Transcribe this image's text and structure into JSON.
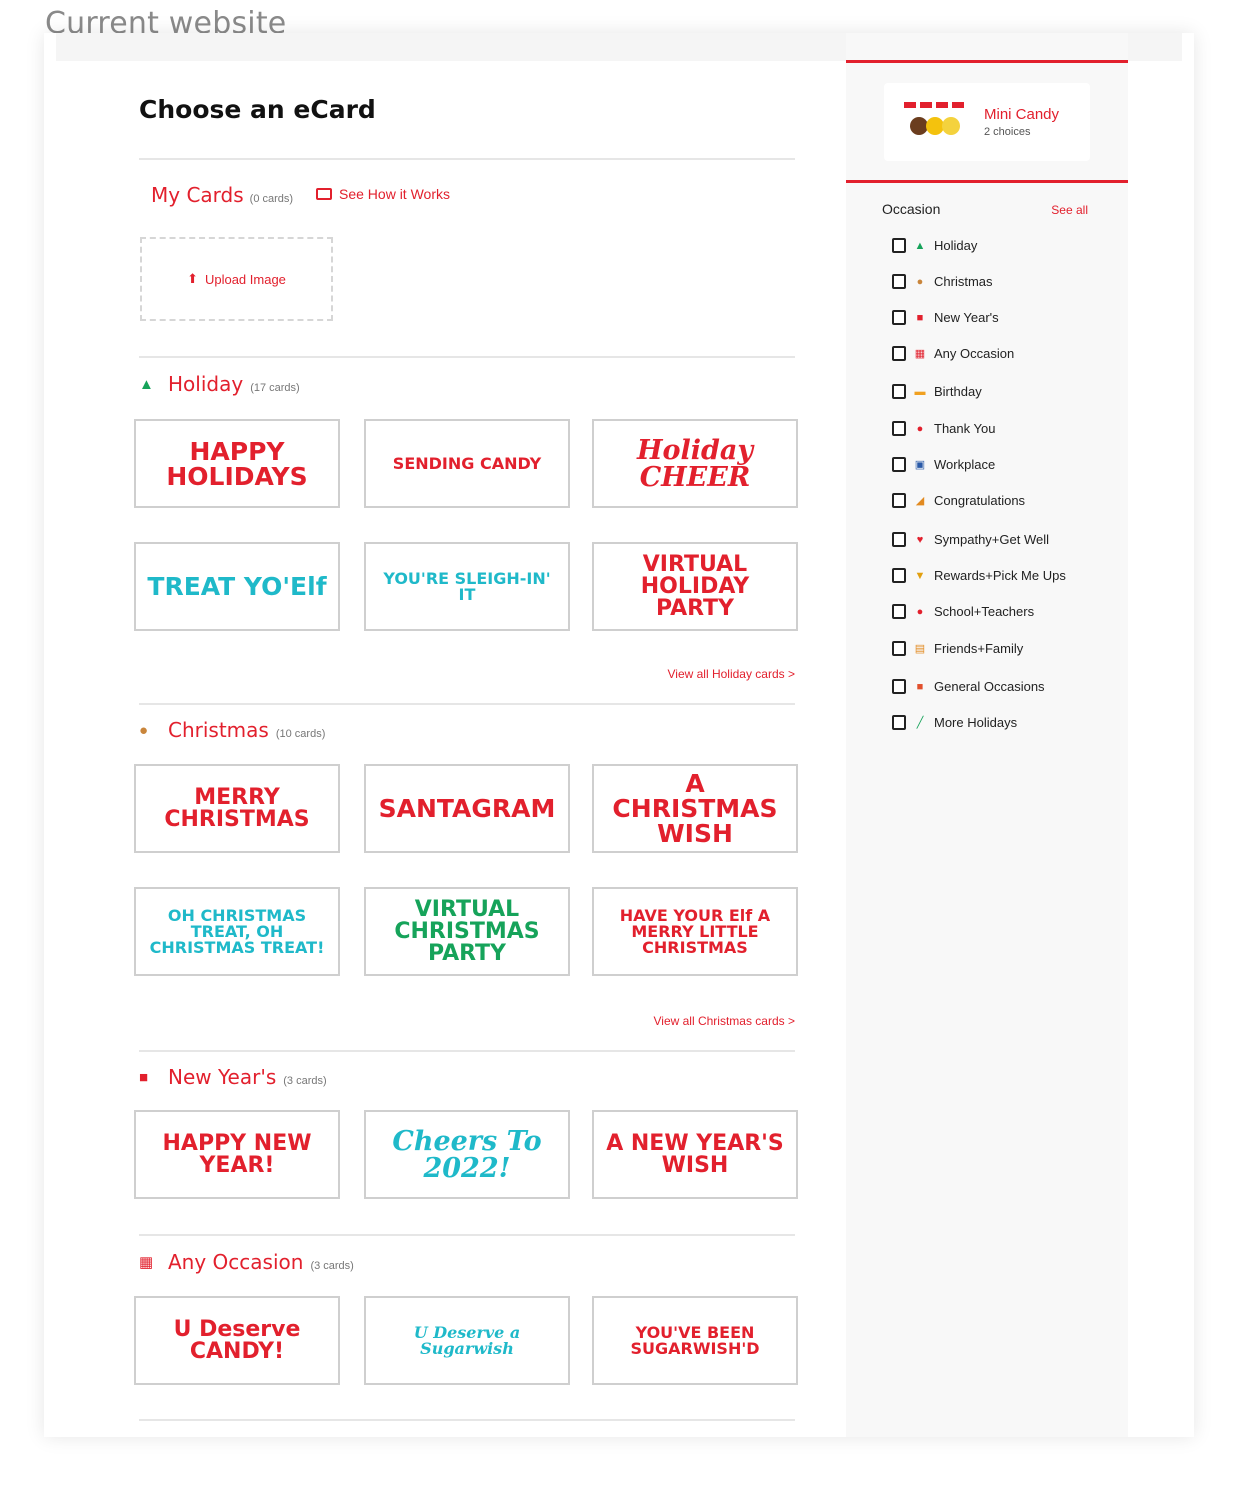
{
  "caption": "Current website",
  "page_title": "Choose an eCard",
  "my_cards": {
    "label": "My Cards",
    "count": "(0 cards)",
    "how_it_works": "See How it Works",
    "upload": "Upload Image"
  },
  "sections": [
    {
      "id": "holiday",
      "label": "Holiday",
      "count": "(17 cards)",
      "icon": "tree-icon",
      "cards": [
        "HAPPY HOLIDAYS",
        "SENDING CANDY",
        "Holiday CHEER",
        "TREAT YO'Elf",
        "YOU'RE SLEIGH-IN' IT",
        "VIRTUAL HOLIDAY PARTY"
      ],
      "view_all": "View all Holiday cards >"
    },
    {
      "id": "christmas",
      "label": "Christmas",
      "count": "(10 cards)",
      "icon": "gingerbread-icon",
      "cards": [
        "MERRY CHRISTMAS",
        "SANTAGRAM",
        "A CHRISTMAS WISH",
        "OH CHRISTMAS TREAT, OH CHRISTMAS TREAT!",
        "VIRTUAL CHRISTMAS PARTY",
        "HAVE YOUR Elf A MERRY LITTLE CHRISTMAS"
      ],
      "view_all": "View all Christmas cards >"
    },
    {
      "id": "newyears",
      "label": "New Year's",
      "count": "(3 cards)",
      "icon": "bag-icon",
      "cards": [
        "HAPPY NEW YEAR!",
        "Cheers To 2022!",
        "A NEW YEAR'S WISH"
      ]
    },
    {
      "id": "anyoccasion",
      "label": "Any Occasion",
      "count": "(3 cards)",
      "icon": "calendar-icon",
      "cards": [
        "U Deserve CANDY!",
        "U Deserve a Sugarwish",
        "YOU'VE BEEN SUGARWISH'D"
      ]
    }
  ],
  "sidebar": {
    "mini": {
      "name": "Mini Candy",
      "sub": "2 choices"
    },
    "occasion_title": "Occasion",
    "see_all": "See all",
    "occasions": [
      {
        "label": "Holiday",
        "icon": "tree-icon"
      },
      {
        "label": "Christmas",
        "icon": "gingerbread-icon"
      },
      {
        "label": "New Year's",
        "icon": "bag-icon"
      },
      {
        "label": "Any Occasion",
        "icon": "calendar-icon"
      },
      {
        "label": "Birthday",
        "icon": "cake-icon"
      },
      {
        "label": "Thank You",
        "icon": "balloon-icon"
      },
      {
        "label": "Workplace",
        "icon": "computer-icon"
      },
      {
        "label": "Congratulations",
        "icon": "party-popper-icon"
      },
      {
        "label": "Sympathy+Get Well",
        "icon": "heart-icon"
      },
      {
        "label": "Rewards+Pick Me Ups",
        "icon": "trophy-icon"
      },
      {
        "label": "School+Teachers",
        "icon": "apple-icon"
      },
      {
        "label": "Friends+Family",
        "icon": "photo-icon"
      },
      {
        "label": "General Occasions",
        "icon": "gift-icon"
      },
      {
        "label": "More Holidays",
        "icon": "pencil-icon"
      }
    ]
  },
  "colors": {
    "accent": "#e2202d",
    "teal": "#1fb9c9",
    "green": "#16a35a",
    "border": "#cfcfcf"
  }
}
